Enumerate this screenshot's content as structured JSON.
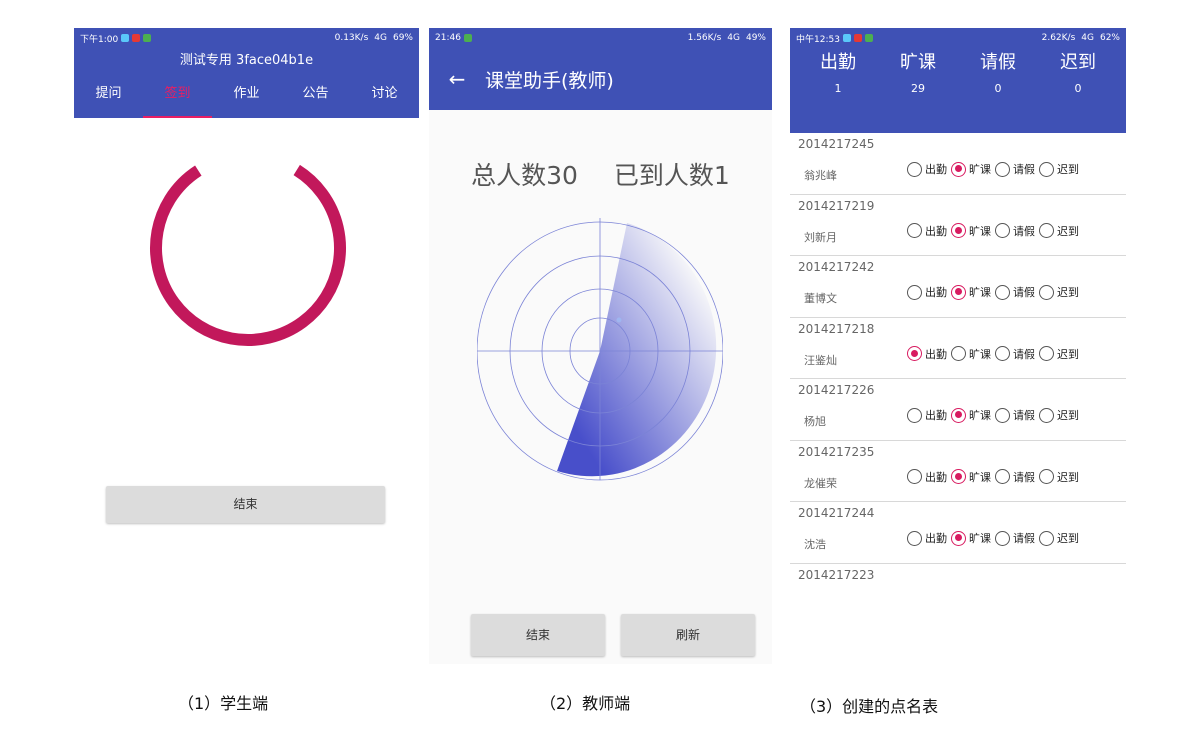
{
  "student": {
    "status": {
      "time": "下午1:00",
      "speed": "0.13K/s",
      "net": "4G",
      "battery": "69%"
    },
    "title": "测试专用 3face04b1e",
    "tabs": [
      "提问",
      "签到",
      "作业",
      "公告",
      "讨论"
    ],
    "active_tab": 1,
    "end_label": "结束",
    "progress": 0.82
  },
  "teacher": {
    "status": {
      "time": "21:46",
      "speed": "1.56K/s",
      "net": "4G",
      "battery": "49%"
    },
    "back_icon": "arrow-left-icon",
    "title": "课堂助手(教师)",
    "total": "总人数30",
    "arrived": "已到人数1",
    "end_label": "结束",
    "refresh_label": "刷新"
  },
  "roster": {
    "status": {
      "time": "中午12:53",
      "speed": "2.62K/s",
      "net": "4G",
      "battery": "62%"
    },
    "summary": [
      {
        "label": "出勤",
        "value": "1"
      },
      {
        "label": "旷课",
        "value": "29"
      },
      {
        "label": "请假",
        "value": "0"
      },
      {
        "label": "迟到",
        "value": "0"
      }
    ],
    "options": [
      "出勤",
      "旷课",
      "请假",
      "迟到"
    ],
    "students": [
      {
        "id": "2014217245",
        "name": "翁兆峰",
        "selected": 1
      },
      {
        "id": "2014217219",
        "name": "刘新月",
        "selected": 1
      },
      {
        "id": "2014217242",
        "name": "董博文",
        "selected": 1
      },
      {
        "id": "2014217218",
        "name": "汪鉴灿",
        "selected": 0
      },
      {
        "id": "2014217226",
        "name": "杨旭",
        "selected": 1
      },
      {
        "id": "2014217235",
        "name": "龙催荣",
        "selected": 1
      },
      {
        "id": "2014217244",
        "name": "沈浩",
        "selected": 1
      }
    ],
    "partial_id": "2014217223"
  },
  "captions": [
    "（1）学生端",
    "（2）教师端",
    "（3）创建的点名表"
  ],
  "colors": {
    "primary": "#3f51b5",
    "accent": "#c2185b"
  }
}
